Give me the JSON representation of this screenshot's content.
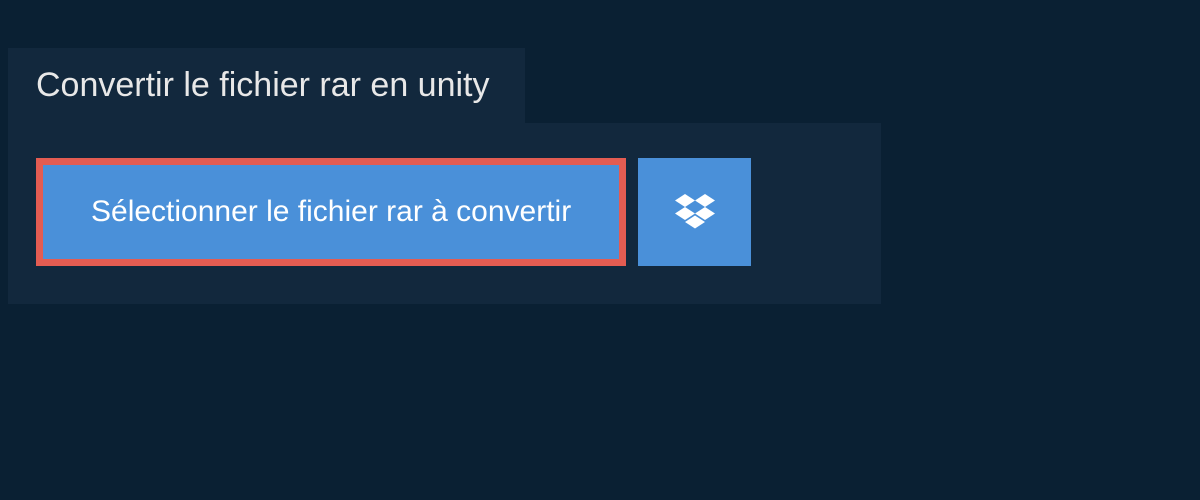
{
  "title": "Convertir le fichier rar en unity",
  "select_button_label": "Sélectionner le fichier rar à convertir",
  "highlight_color": "#e35c52",
  "button_color": "#4a90d9"
}
